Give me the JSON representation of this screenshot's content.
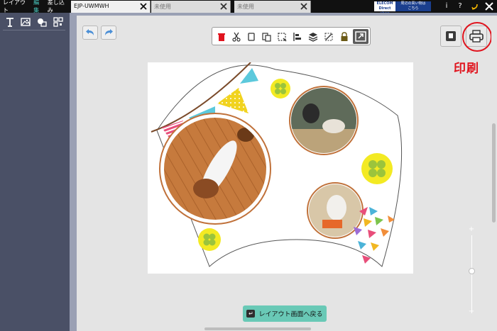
{
  "mode_tabs": [
    {
      "label": "レイアウト"
    },
    {
      "label": "編集"
    },
    {
      "label": "差し込み"
    }
  ],
  "document_tabs": [
    {
      "label": "EJP-UWMWH"
    },
    {
      "label": "未使用"
    },
    {
      "label": "未使用"
    }
  ],
  "brand": {
    "name": "ELECOM",
    "sub": "Direct shop",
    "promo_line1": "周辺の買い物は",
    "promo_line2": "こちら"
  },
  "top_icons": {
    "info": "i",
    "help": "?"
  },
  "annotation": {
    "label": "印刷",
    "color": "#e0141e"
  },
  "back_button": {
    "icon": "↵",
    "label": "レイアウト画面へ戻る"
  },
  "zoom": {
    "plus": "+",
    "minus": "−",
    "level_fraction": 0.55
  },
  "toolbar": {
    "icons": [
      "delete-icon",
      "cut-icon",
      "copy-icon",
      "paste-icon",
      "select-icon",
      "align-icon",
      "layers-icon",
      "transform-icon",
      "lock-icon",
      "fit-icon"
    ]
  },
  "colors": {
    "accent": "#49c8c0",
    "panel": "#4a5066",
    "back_button": "#69c9b6",
    "clover_circle": "#f3ea23",
    "clover": "#9bc43c"
  }
}
